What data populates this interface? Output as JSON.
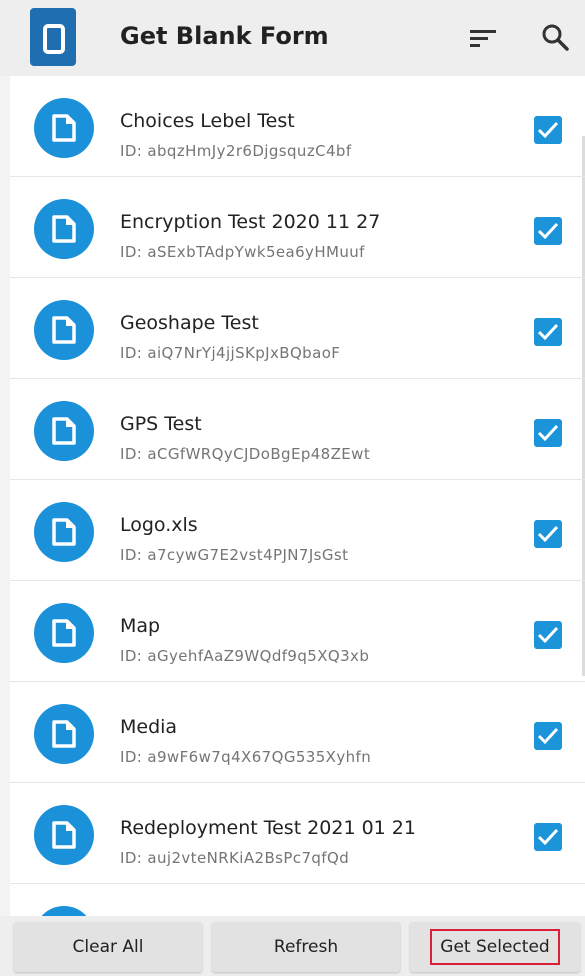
{
  "header": {
    "title": "Get Blank Form"
  },
  "forms": [
    {
      "name": "Choices Lebel Test",
      "id": "ID: abqzHmJy2r6DjgsquzC4bf"
    },
    {
      "name": "Encryption Test 2020 11 27",
      "id": "ID: aSExbTAdpYwk5ea6yHMuuf"
    },
    {
      "name": "Geoshape Test",
      "id": "ID: aiQ7NrYj4jjSKpJxBQbaoF"
    },
    {
      "name": "GPS Test",
      "id": "ID: aCGfWRQyCJDoBgEp48ZEwt"
    },
    {
      "name": "Logo.xls",
      "id": "ID: a7cywG7E2vst4PJN7JsGst"
    },
    {
      "name": "Map",
      "id": "ID: aGyehfAaZ9WQdf9q5XQ3xb"
    },
    {
      "name": "Media",
      "id": "ID: a9wF6w7q4X67QG535Xyhfn"
    },
    {
      "name": "Redeployment Test 2021 01 21",
      "id": "ID: auj2vteNRKiA2BsPc7qfQd"
    }
  ],
  "buttons": {
    "clear_all": "Clear All",
    "refresh": "Refresh",
    "get_selected": "Get Selected"
  },
  "colors": {
    "accent": "#1a91d8",
    "highlight": "#d8203a"
  },
  "icons": {
    "app": "phone-app-icon",
    "sort": "sort-icon",
    "search": "search-icon",
    "form": "document-icon",
    "check": "check-icon"
  }
}
